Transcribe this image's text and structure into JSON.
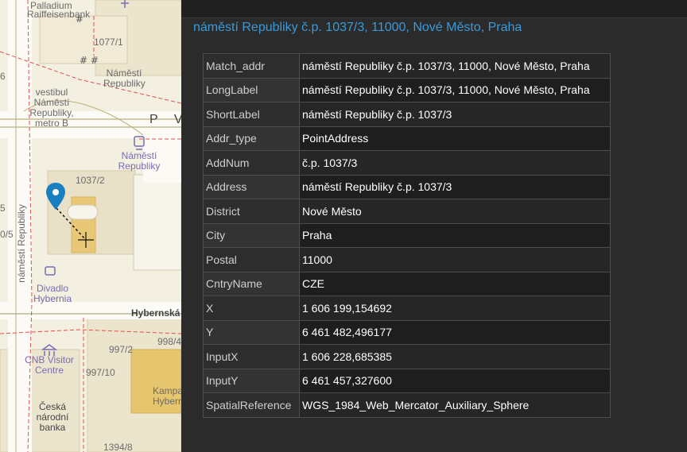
{
  "map": {
    "labels": {
      "palladium": "Palladium",
      "raiffeisenbank": "Raiffeisenbank",
      "bldg_1077_1": "1077/1",
      "namesti_republiky_stop": "Náměstí Republiky",
      "vestibul": "vestibul Náměstí Republiky, metro B",
      "street_pv": "P V O",
      "namesti_republiky_metro": "Náměstí Republiky",
      "bldg_1037_2": "1037/2",
      "street_namesti_republiky": "náměstí Republiky",
      "divadlo_hybernia": "Divadlo Hybernia",
      "hybernska": "Hybernská",
      "bldg_997_2": "997/2",
      "bldg_998_4": "998/4",
      "cnb_visitor": "CNB Visitor Centre",
      "bldg_997_10": "997/10",
      "kampa_hybernia": "Kampa Hybern",
      "ceska_narodni_banka": "Česká národní banka",
      "bldg_1394_8": "1394/8",
      "edge_6": "6",
      "edge_5": "5",
      "edge_0_5": "0/5"
    },
    "colors": {
      "background": "#f3efe1",
      "pin": "#1a7fc1",
      "poi": "#7b6bb0",
      "boundary": "#e05050"
    }
  },
  "popup": {
    "title": "náměstí Republiky č.p. 1037/3, 11000, Nové Město, Praha",
    "title_color": "#3a9ad9",
    "rows": [
      {
        "key": "Match_addr",
        "value": "náměstí Republiky č.p. 1037/3, 11000, Nové Město, Praha"
      },
      {
        "key": "LongLabel",
        "value": "náměstí Republiky č.p. 1037/3, 11000, Nové Město, Praha"
      },
      {
        "key": "ShortLabel",
        "value": "náměstí Republiky č.p. 1037/3"
      },
      {
        "key": "Addr_type",
        "value": "PointAddress"
      },
      {
        "key": "AddNum",
        "value": "č.p. 1037/3"
      },
      {
        "key": "Address",
        "value": "náměstí Republiky č.p. 1037/3"
      },
      {
        "key": "District",
        "value": "Nové Město"
      },
      {
        "key": "City",
        "value": "Praha"
      },
      {
        "key": "Postal",
        "value": "11000"
      },
      {
        "key": "CntryName",
        "value": "CZE"
      },
      {
        "key": "X",
        "value": "1 606 199,154692"
      },
      {
        "key": "Y",
        "value": "6 461 482,496177"
      },
      {
        "key": "InputX",
        "value": "1 606 228,685385"
      },
      {
        "key": "InputY",
        "value": "6 461 457,327600"
      },
      {
        "key": "SpatialReference",
        "value": "WGS_1984_Web_Mercator_Auxiliary_Sphere"
      }
    ]
  }
}
